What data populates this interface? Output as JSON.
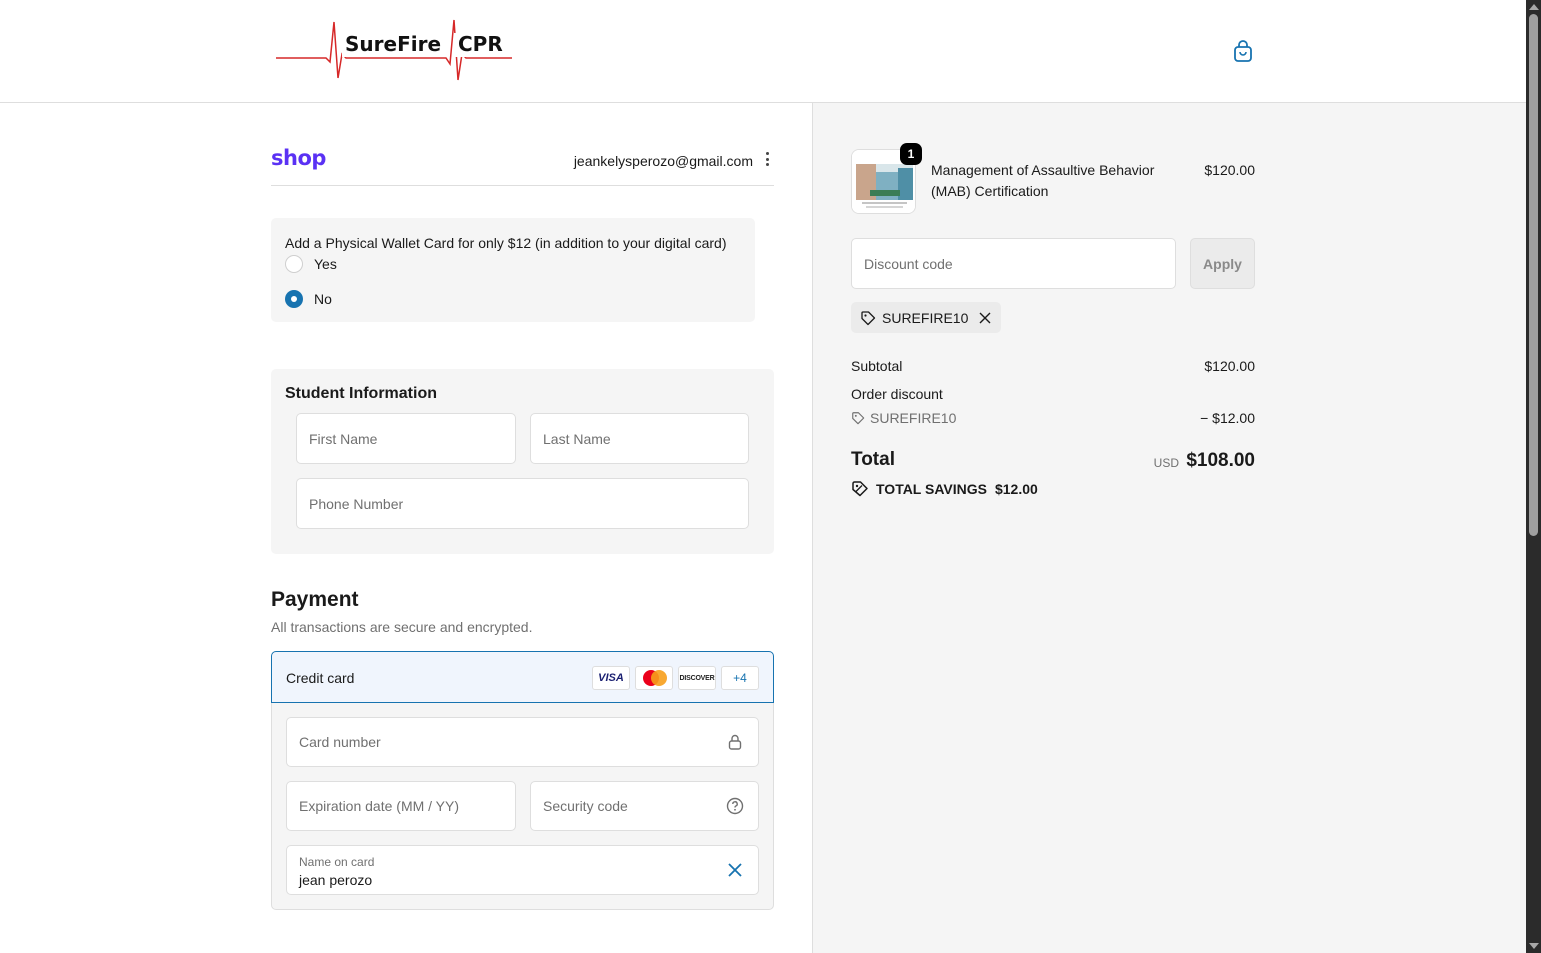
{
  "header": {
    "brand_name_left": "SureFire",
    "brand_name_right": "CPR",
    "cart_icon": "shopping-bag-icon"
  },
  "account": {
    "shop_logo_text": "shop",
    "email": "jeankelysperozo@gmail.com",
    "menu_icon": "kebab-menu-icon"
  },
  "wallet_card": {
    "question": "Add a Physical Wallet Card for only $12 (in addition to your digital card)",
    "options": [
      {
        "label": "Yes",
        "selected": false
      },
      {
        "label": "No",
        "selected": true
      }
    ]
  },
  "student_info": {
    "title": "Student Information",
    "first_name_placeholder": "First Name",
    "last_name_placeholder": "Last Name",
    "phone_placeholder": "Phone Number"
  },
  "payment": {
    "title": "Payment",
    "subtitle": "All transactions are secure and encrypted.",
    "method_label": "Credit card",
    "card_brands": [
      "VISA",
      "Mastercard",
      "DISCOVER"
    ],
    "more_brands": "+4",
    "card_number_placeholder": "Card number",
    "expiration_placeholder": "Expiration date (MM / YY)",
    "security_code_placeholder": "Security code",
    "name_on_card_label": "Name on card",
    "name_on_card_value": "jean perozo"
  },
  "order_summary": {
    "product": {
      "name": "Management of Assaultive Behavior (MAB) Certification",
      "price": "$120.00",
      "quantity": "1"
    },
    "discount_placeholder": "Discount code",
    "apply_label": "Apply",
    "applied_code": "SUREFIRE10",
    "subtotal_label": "Subtotal",
    "subtotal_value": "$120.00",
    "order_discount_label": "Order discount",
    "discount_code": "SUREFIRE10",
    "discount_value": "− $12.00",
    "total_label": "Total",
    "currency": "USD",
    "total_value": "$108.00",
    "savings_label": "TOTAL SAVINGS",
    "savings_value": "$12.00"
  },
  "colors": {
    "accent": "#1773b0",
    "shop_purple": "#5a31f4",
    "panel_bg": "#f5f5f5",
    "logo_red": "#d62828"
  }
}
